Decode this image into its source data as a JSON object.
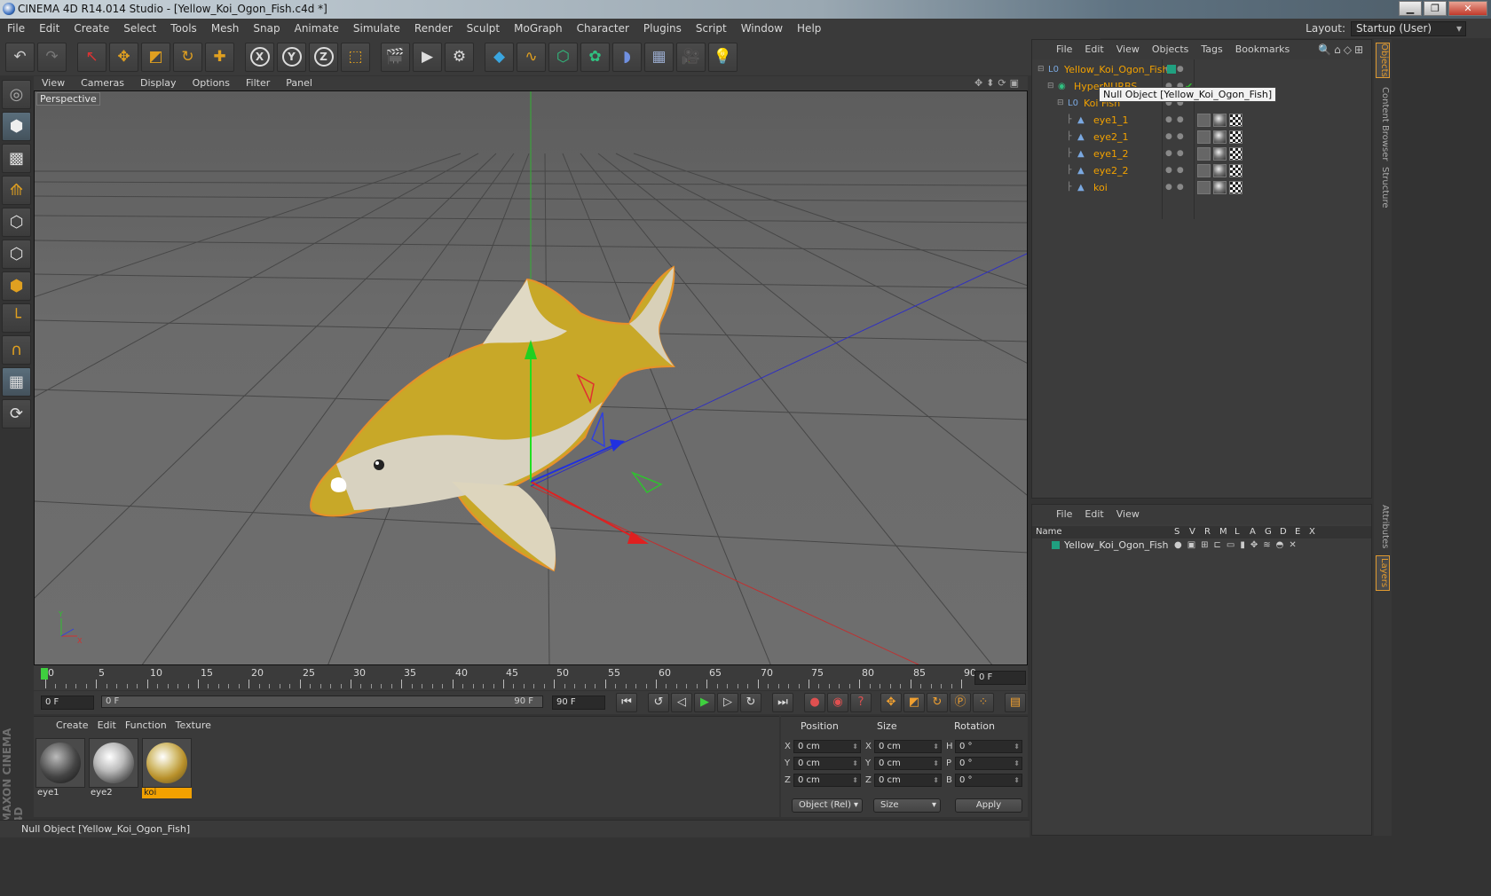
{
  "window": {
    "title": "CINEMA 4D R14.014 Studio - [Yellow_Koi_Ogon_Fish.c4d *]"
  },
  "menu": [
    "File",
    "Edit",
    "Create",
    "Select",
    "Tools",
    "Mesh",
    "Snap",
    "Animate",
    "Simulate",
    "Render",
    "Sculpt",
    "MoGraph",
    "Character",
    "Plugins",
    "Script",
    "Window",
    "Help"
  ],
  "layout": {
    "label": "Layout:",
    "value": "Startup (User)"
  },
  "toolbar_icons": [
    "undo-icon",
    "redo-icon",
    "live-selection-icon",
    "move-icon",
    "scale-icon",
    "rotate-icon",
    "recent-tool-icon",
    "x-axis-lock-icon",
    "y-axis-lock-icon",
    "z-axis-lock-icon",
    "coordinate-system-icon",
    "render-view-icon",
    "render-picture-viewer-icon",
    "render-settings-icon",
    "cube-icon",
    "spline-icon",
    "nurbs-icon",
    "array-icon",
    "deformer-icon",
    "floor-icon",
    "camera-icon",
    "light-icon"
  ],
  "axis_letters": [
    "X",
    "Y",
    "Z"
  ],
  "left_tools": [
    "model-mode-icon",
    "texture-mode-icon",
    "workplane-icon",
    "points-mode-icon",
    "edges-mode-icon",
    "polygons-mode-icon",
    "axis-mode-icon",
    "magnet-icon",
    "snap-icon",
    "lock-workplane-icon"
  ],
  "viewport_menu": [
    "View",
    "Cameras",
    "Display",
    "Options",
    "Filter",
    "Panel"
  ],
  "viewport_label": "Perspective",
  "timeline": {
    "ticks": [
      "0",
      "5",
      "10",
      "15",
      "20",
      "25",
      "30",
      "35",
      "40",
      "45",
      "50",
      "55",
      "60",
      "65",
      "70",
      "75",
      "80",
      "85",
      "90"
    ],
    "current_frame": "0 F"
  },
  "transport": {
    "start": "0 F",
    "range_start": "0 F",
    "range_end": "90 F",
    "end": "90 F"
  },
  "materials": {
    "menu": [
      "Create",
      "Edit",
      "Function",
      "Texture"
    ],
    "items": [
      {
        "name": "eye1"
      },
      {
        "name": "eye2"
      },
      {
        "name": "koi"
      }
    ]
  },
  "coords": {
    "headers": [
      "Position",
      "Size",
      "Rotation"
    ],
    "rows": [
      {
        "pos_label": "X",
        "pos": "0 cm",
        "size_label": "X",
        "size": "0 cm",
        "rot_label": "H",
        "rot": "0 °"
      },
      {
        "pos_label": "Y",
        "pos": "0 cm",
        "size_label": "Y",
        "size": "0 cm",
        "rot_label": "P",
        "rot": "0 °"
      },
      {
        "pos_label": "Z",
        "pos": "0 cm",
        "size_label": "Z",
        "size": "0 cm",
        "rot_label": "B",
        "rot": "0 °"
      }
    ],
    "mode": "Object (Rel)",
    "size_mode": "Size",
    "apply": "Apply"
  },
  "status": "Null Object [Yellow_Koi_Ogon_Fish]",
  "objects": {
    "menu": [
      "File",
      "Edit",
      "View",
      "Objects",
      "Tags",
      "Bookmarks"
    ],
    "tree": [
      {
        "name": "Yellow_Koi_Ogon_Fish",
        "depth": 0
      },
      {
        "name": "HyperNURBS",
        "depth": 1
      },
      {
        "name": "Koi Fish",
        "depth": 2
      },
      {
        "name": "eye1_1",
        "depth": 3
      },
      {
        "name": "eye2_1",
        "depth": 3
      },
      {
        "name": "eye1_2",
        "depth": 3
      },
      {
        "name": "eye2_2",
        "depth": 3
      },
      {
        "name": "koi",
        "depth": 3
      }
    ],
    "tooltip": "Null Object [Yellow_Koi_Ogon_Fish]"
  },
  "layers": {
    "menu": [
      "File",
      "Edit",
      "View"
    ],
    "columns": [
      "Name",
      "S",
      "V",
      "R",
      "M",
      "L",
      "A",
      "G",
      "D",
      "E",
      "X"
    ],
    "row": "Yellow_Koi_Ogon_Fish"
  },
  "side_tabs": [
    "Objects",
    "Content Browser",
    "Structure",
    "Attributes",
    "Layers"
  ],
  "colors": {
    "accent": "#f2a100",
    "axis_x": "#e03030",
    "axis_y": "#30c030",
    "axis_z": "#3040e0"
  }
}
